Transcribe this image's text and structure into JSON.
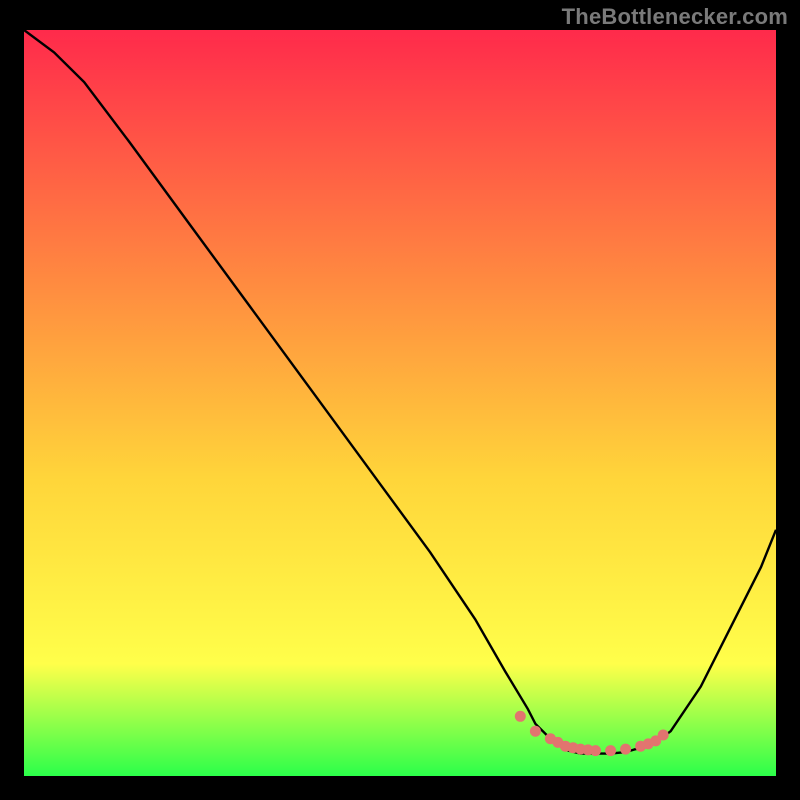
{
  "watermark": "TheBottlenecker.com",
  "colors": {
    "black": "#000000",
    "curve": "#000000",
    "marker": "#e2746f",
    "gradient_top": "#ff2a4b",
    "gradient_mid1": "#ff8b40",
    "gradient_mid2": "#ffd53a",
    "gradient_mid3": "#ffff4a",
    "gradient_bottom": "#2bff4a"
  },
  "chart_data": {
    "type": "line",
    "title": "",
    "xlabel": "",
    "ylabel": "",
    "xlim": [
      0,
      100
    ],
    "ylim": [
      0,
      100
    ],
    "series": [
      {
        "name": "bottleneck-curve",
        "x": [
          0,
          4,
          8,
          14,
          22,
          30,
          38,
          46,
          54,
          60,
          64,
          67,
          68,
          70,
          72,
          74,
          76,
          78,
          80,
          82,
          84,
          86,
          90,
          94,
          98,
          100
        ],
        "values": [
          100,
          97,
          93,
          85,
          74,
          63,
          52,
          41,
          30,
          21,
          14,
          9,
          7,
          5,
          3.5,
          3,
          3,
          3,
          3.2,
          3.8,
          4.5,
          6,
          12,
          20,
          28,
          33
        ]
      }
    ],
    "markers": {
      "name": "valley-markers",
      "x": [
        66,
        68,
        70,
        71,
        72,
        73,
        74,
        75,
        76,
        78,
        80,
        82,
        83,
        84,
        85
      ],
      "values": [
        8,
        6,
        5,
        4.5,
        4,
        3.8,
        3.6,
        3.5,
        3.4,
        3.4,
        3.6,
        4,
        4.3,
        4.7,
        5.5
      ]
    }
  }
}
